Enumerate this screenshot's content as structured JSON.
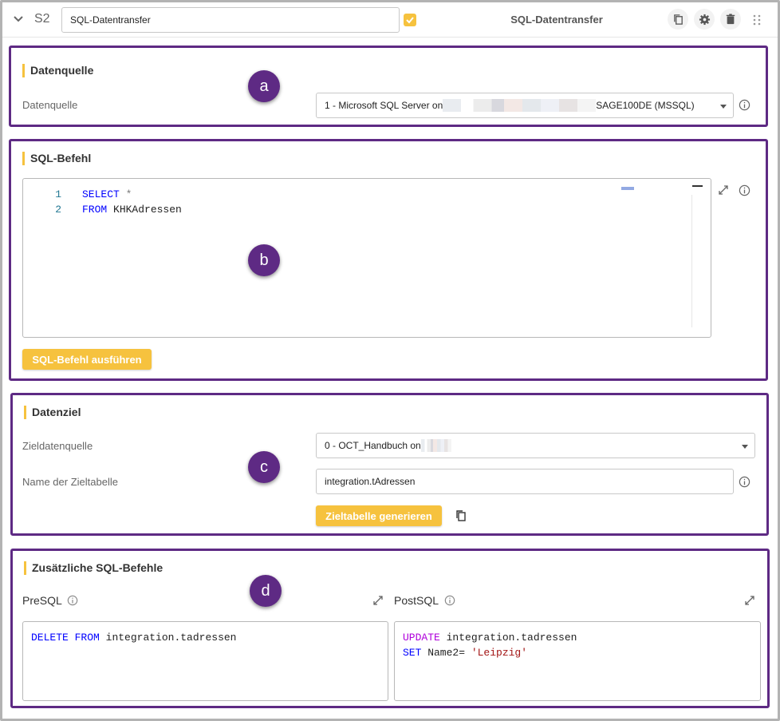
{
  "header": {
    "step": "S2",
    "name_value": "SQL-Datentransfer",
    "title": "SQL-Datentransfer"
  },
  "datenquelle": {
    "section_title": "Datenquelle",
    "label": "Datenquelle",
    "select_prefix": "1 - Microsoft SQL Server on",
    "select_suffix": "SAGE100DE (MSSQL)",
    "badge": "a"
  },
  "sql_befehl": {
    "section_title": "SQL-Befehl",
    "lines": [
      {
        "num": "1",
        "keyword": "SELECT",
        "rest": " *"
      },
      {
        "num": "2",
        "keyword": "FROM",
        "rest": " KHKAdressen"
      }
    ],
    "run_button": "SQL-Befehl ausführen",
    "badge": "b"
  },
  "datenziel": {
    "section_title": "Datenziel",
    "target_label": "Zieldatenquelle",
    "target_select_prefix": "0 - OCT_Handbuch on",
    "table_label": "Name der Zieltabelle",
    "table_value": "integration.tAdressen",
    "generate_button": "Zieltabelle generieren",
    "badge": "c"
  },
  "zusatz": {
    "section_title": "Zusätzliche SQL-Befehle",
    "presql_label": "PreSQL",
    "postsql_label": "PostSQL",
    "presql": {
      "kw1": "DELETE",
      "kw2": "FROM",
      "rest": " integration.tadressen"
    },
    "postsql": {
      "line1_kw": "UPDATE",
      "line1_rest": " integration.tadressen",
      "line2_kw": "SET",
      "line2_mid": " Name2= ",
      "line2_str": "'Leipzig'"
    },
    "badge": "d"
  },
  "colors": {
    "accent": "#f6c23e",
    "frame": "#5e2a84",
    "keyword": "#0000ff"
  }
}
